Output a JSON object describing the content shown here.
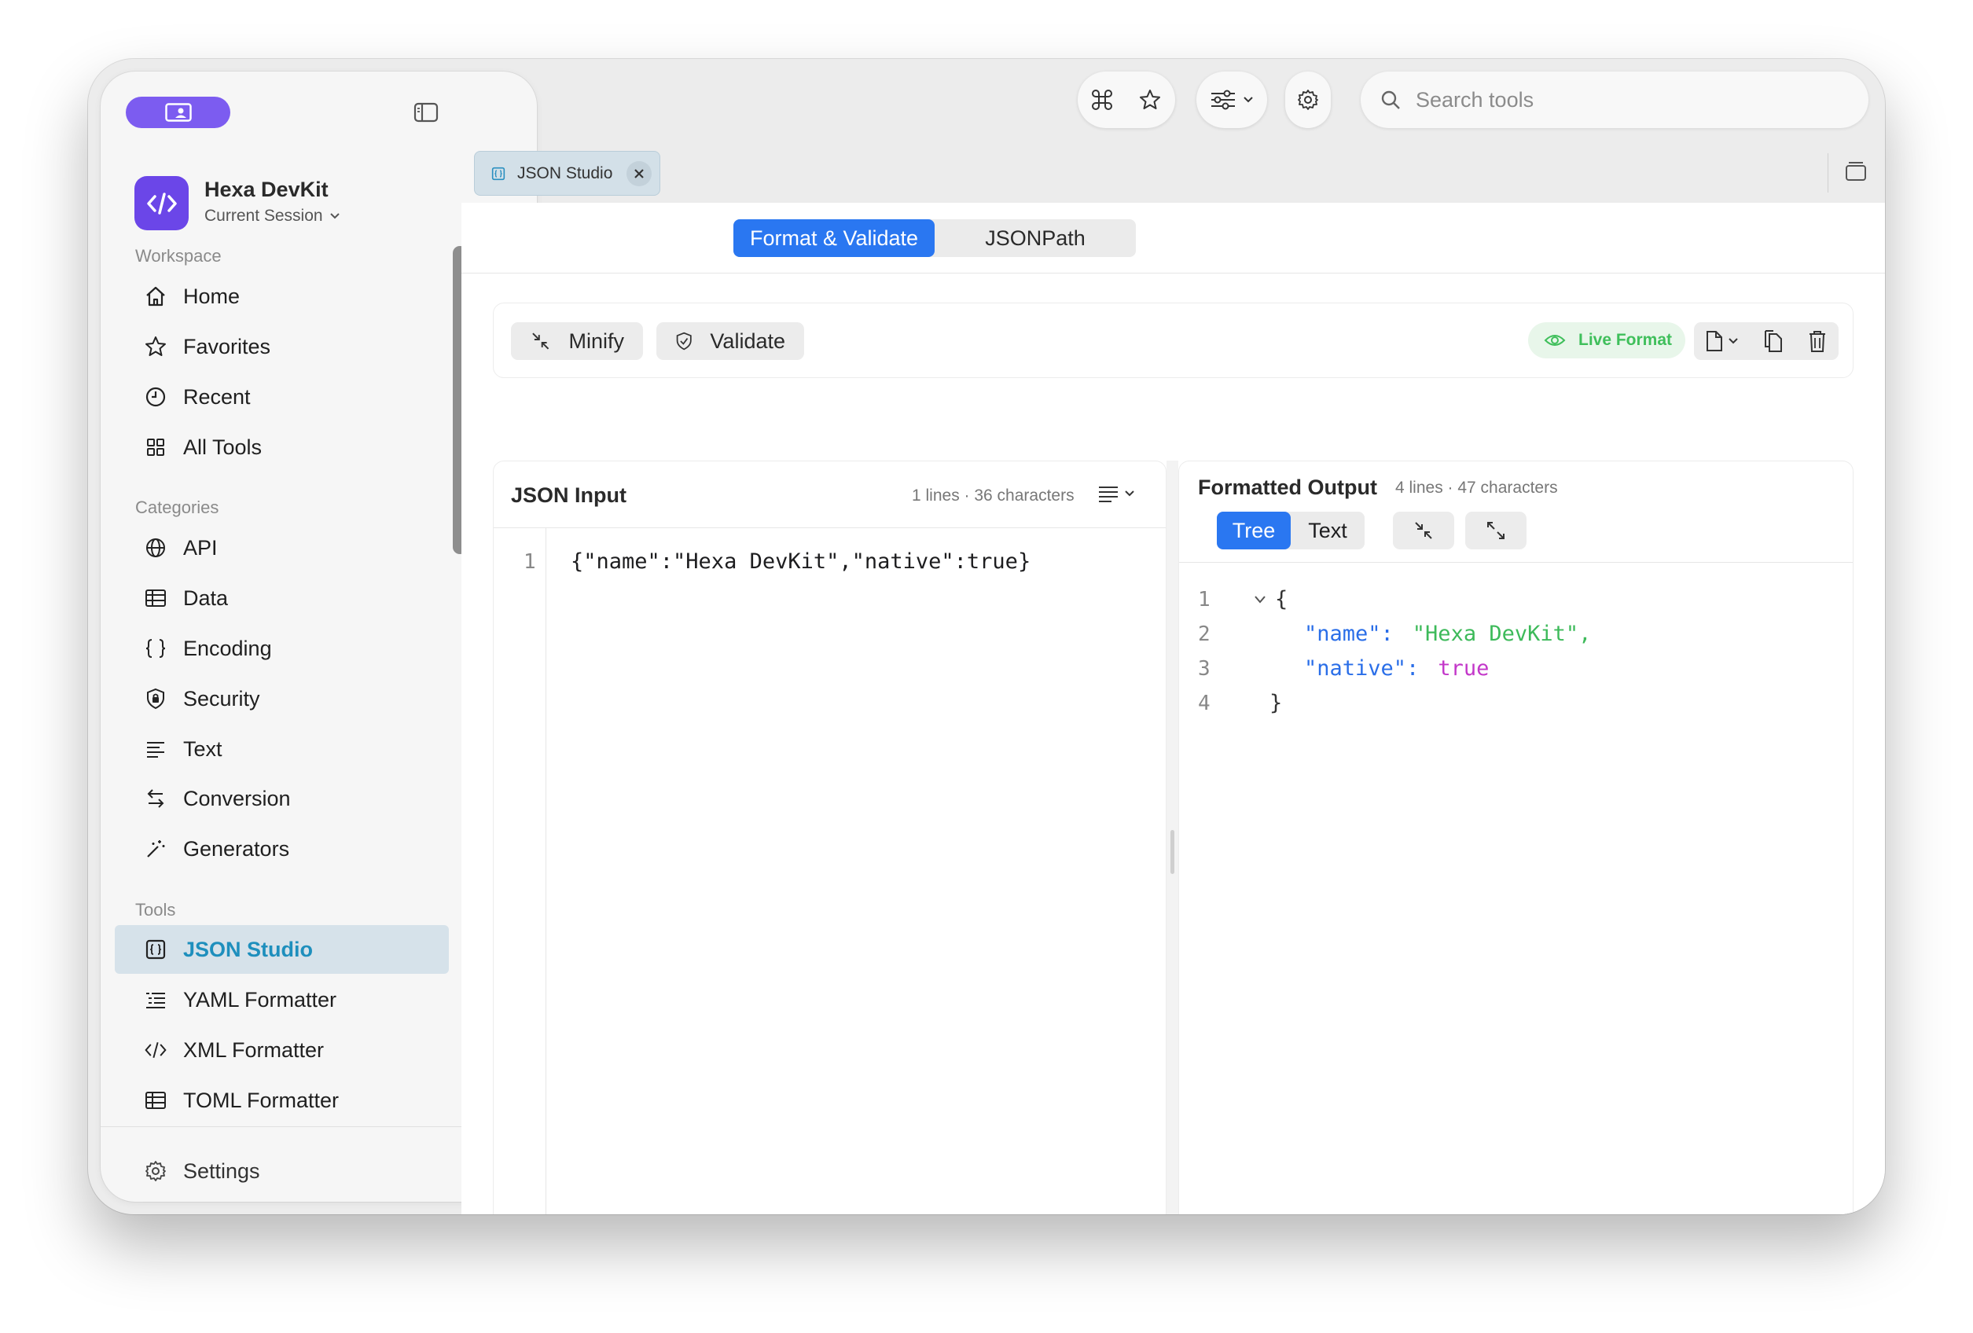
{
  "app": {
    "name": "Hexa DevKit",
    "session": "Current Session"
  },
  "sidebar": {
    "sections": {
      "workspace": "Workspace",
      "categories": "Categories",
      "tools": "Tools"
    },
    "workspace_items": [
      {
        "label": "Home",
        "icon": "home-icon"
      },
      {
        "label": "Favorites",
        "icon": "star-icon"
      },
      {
        "label": "Recent",
        "icon": "clock-icon"
      },
      {
        "label": "All Tools",
        "icon": "grid-icon"
      }
    ],
    "category_items": [
      {
        "label": "API",
        "icon": "globe-icon"
      },
      {
        "label": "Data",
        "icon": "table-icon"
      },
      {
        "label": "Encoding",
        "icon": "braces-icon"
      },
      {
        "label": "Security",
        "icon": "shield-icon"
      },
      {
        "label": "Text",
        "icon": "text-lines-icon"
      },
      {
        "label": "Conversion",
        "icon": "arrows-swap-icon"
      },
      {
        "label": "Generators",
        "icon": "magic-wand-icon"
      }
    ],
    "tool_items": [
      {
        "label": "JSON Studio",
        "icon": "json-file-icon",
        "active": true
      },
      {
        "label": "YAML Formatter",
        "icon": "list-indent-icon"
      },
      {
        "label": "XML Formatter",
        "icon": "code-brackets-icon"
      },
      {
        "label": "TOML Formatter",
        "icon": "table-icon"
      }
    ],
    "settings": "Settings"
  },
  "toolbar": {
    "search_placeholder": "Search tools"
  },
  "tabs": [
    {
      "label": "JSON Studio"
    }
  ],
  "mode_tabs": {
    "format": "Format & Validate",
    "jsonpath": "JSONPath"
  },
  "actions": {
    "minify": "Minify",
    "validate": "Validate",
    "live_format": "Live Format"
  },
  "input_panel": {
    "title": "JSON Input",
    "meta": "1 lines · 36 characters",
    "line_numbers": [
      "1"
    ],
    "content": "{\"name\":\"Hexa DevKit\",\"native\":true}"
  },
  "output_panel": {
    "title": "Formatted Output",
    "meta": "4 lines · 47 characters",
    "view_tree": "Tree",
    "view_text": "Text",
    "line_numbers": [
      "1",
      "2",
      "3",
      "4"
    ],
    "lines": {
      "open": "{",
      "key1": "\"name\":",
      "val1": "\"Hexa DevKit\",",
      "key2": "\"native\":",
      "val2": "true",
      "close": "}"
    }
  },
  "colors": {
    "accent": "#2a77f1",
    "brand": "#6b46e8",
    "active_tool_text": "#1e8fbd",
    "live_green": "#3fbf5b"
  }
}
